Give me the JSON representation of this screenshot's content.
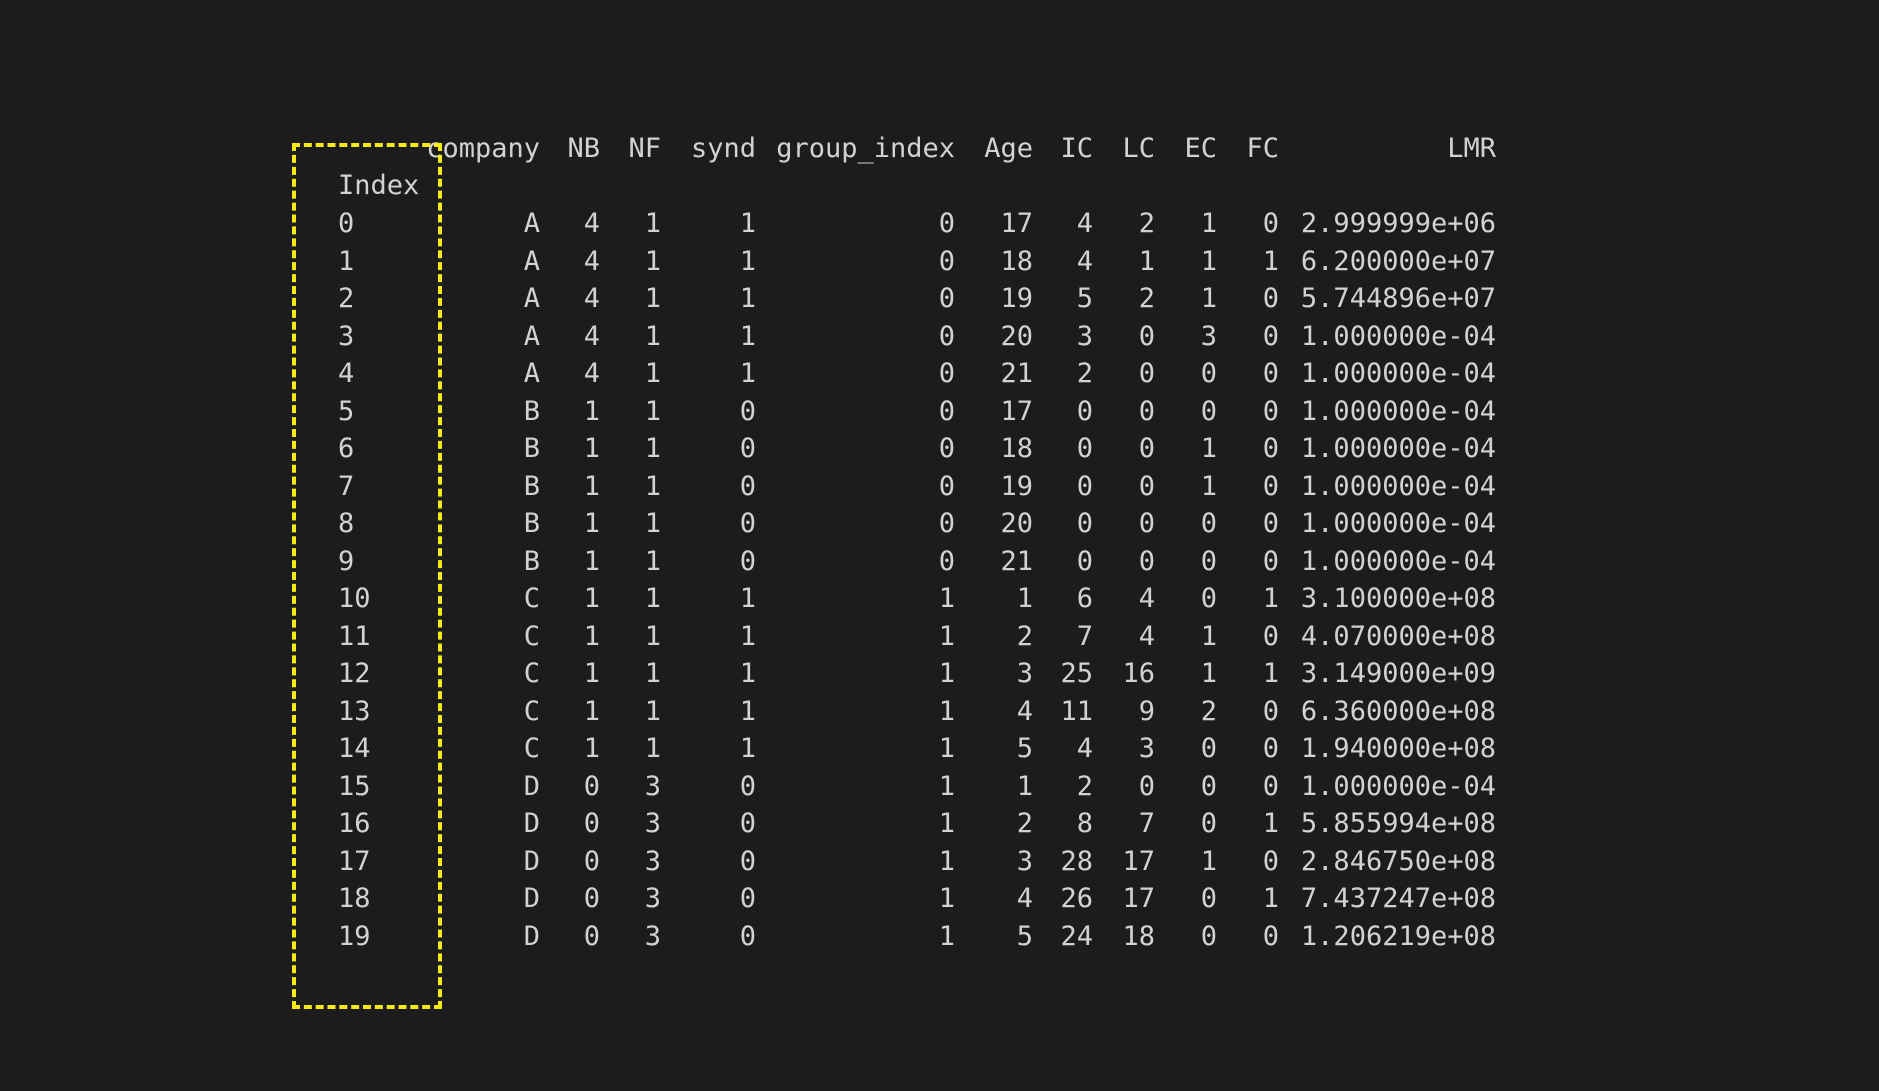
{
  "dataframe": {
    "columns": [
      "company",
      "NB",
      "NF",
      "synd",
      "group_index",
      "Age",
      "IC",
      "LC",
      "EC",
      "FC",
      "LMR"
    ],
    "index_name": "Index",
    "rows": [
      {
        "index": "0",
        "cells": [
          "A",
          "4",
          "1",
          "1",
          "0",
          "17",
          "4",
          "2",
          "1",
          "0",
          "2.999999e+06"
        ]
      },
      {
        "index": "1",
        "cells": [
          "A",
          "4",
          "1",
          "1",
          "0",
          "18",
          "4",
          "1",
          "1",
          "1",
          "6.200000e+07"
        ]
      },
      {
        "index": "2",
        "cells": [
          "A",
          "4",
          "1",
          "1",
          "0",
          "19",
          "5",
          "2",
          "1",
          "0",
          "5.744896e+07"
        ]
      },
      {
        "index": "3",
        "cells": [
          "A",
          "4",
          "1",
          "1",
          "0",
          "20",
          "3",
          "0",
          "3",
          "0",
          "1.000000e-04"
        ]
      },
      {
        "index": "4",
        "cells": [
          "A",
          "4",
          "1",
          "1",
          "0",
          "21",
          "2",
          "0",
          "0",
          "0",
          "1.000000e-04"
        ]
      },
      {
        "index": "5",
        "cells": [
          "B",
          "1",
          "1",
          "0",
          "0",
          "17",
          "0",
          "0",
          "0",
          "0",
          "1.000000e-04"
        ]
      },
      {
        "index": "6",
        "cells": [
          "B",
          "1",
          "1",
          "0",
          "0",
          "18",
          "0",
          "0",
          "1",
          "0",
          "1.000000e-04"
        ]
      },
      {
        "index": "7",
        "cells": [
          "B",
          "1",
          "1",
          "0",
          "0",
          "19",
          "0",
          "0",
          "1",
          "0",
          "1.000000e-04"
        ]
      },
      {
        "index": "8",
        "cells": [
          "B",
          "1",
          "1",
          "0",
          "0",
          "20",
          "0",
          "0",
          "0",
          "0",
          "1.000000e-04"
        ]
      },
      {
        "index": "9",
        "cells": [
          "B",
          "1",
          "1",
          "0",
          "0",
          "21",
          "0",
          "0",
          "0",
          "0",
          "1.000000e-04"
        ]
      },
      {
        "index": "10",
        "cells": [
          "C",
          "1",
          "1",
          "1",
          "1",
          "1",
          "6",
          "4",
          "0",
          "1",
          "3.100000e+08"
        ]
      },
      {
        "index": "11",
        "cells": [
          "C",
          "1",
          "1",
          "1",
          "1",
          "2",
          "7",
          "4",
          "1",
          "0",
          "4.070000e+08"
        ]
      },
      {
        "index": "12",
        "cells": [
          "C",
          "1",
          "1",
          "1",
          "1",
          "3",
          "25",
          "16",
          "1",
          "1",
          "3.149000e+09"
        ]
      },
      {
        "index": "13",
        "cells": [
          "C",
          "1",
          "1",
          "1",
          "1",
          "4",
          "11",
          "9",
          "2",
          "0",
          "6.360000e+08"
        ]
      },
      {
        "index": "14",
        "cells": [
          "C",
          "1",
          "1",
          "1",
          "1",
          "5",
          "4",
          "3",
          "0",
          "0",
          "1.940000e+08"
        ]
      },
      {
        "index": "15",
        "cells": [
          "D",
          "0",
          "3",
          "0",
          "1",
          "1",
          "2",
          "0",
          "0",
          "0",
          "1.000000e-04"
        ]
      },
      {
        "index": "16",
        "cells": [
          "D",
          "0",
          "3",
          "0",
          "1",
          "2",
          "8",
          "7",
          "0",
          "1",
          "5.855994e+08"
        ]
      },
      {
        "index": "17",
        "cells": [
          "D",
          "0",
          "3",
          "0",
          "1",
          "3",
          "28",
          "17",
          "1",
          "0",
          "2.846750e+08"
        ]
      },
      {
        "index": "18",
        "cells": [
          "D",
          "0",
          "3",
          "0",
          "1",
          "4",
          "26",
          "17",
          "0",
          "1",
          "7.437247e+08"
        ]
      },
      {
        "index": "19",
        "cells": [
          "D",
          "0",
          "3",
          "0",
          "1",
          "5",
          "24",
          "18",
          "0",
          "0",
          "1.206219e+08"
        ]
      }
    ]
  },
  "colors": {
    "background": "#1c1c1c",
    "text": "#d2d2d2",
    "highlight_border": "#f5ea16"
  }
}
